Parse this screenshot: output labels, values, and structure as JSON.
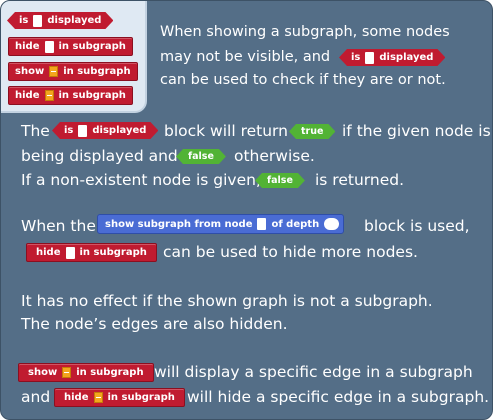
{
  "palette": {
    "is_displayed": {
      "left": "is",
      "right": "displayed"
    },
    "hide_in_subgraph": {
      "left": "hide",
      "right": "in subgraph"
    },
    "show_edge_in_subgraph": {
      "left": "show",
      "right": "in subgraph"
    },
    "hide_edge_in_subgraph": {
      "left": "hide",
      "right": "in subgraph"
    }
  },
  "intro": {
    "line1": "When showing a subgraph, some nodes",
    "line2": "may not be visible, and",
    "line3": "can be used to check if they are or not."
  },
  "para1": {
    "the": "The",
    "block_will_return": "block will return",
    "if_given": "if the given node is",
    "being_displayed": "being displayed and",
    "otherwise": "otherwise.",
    "nonexistent": "If a non-existent node is given,",
    "is_returned": "is returned."
  },
  "para2": {
    "when_the": "When the",
    "block_is_used": "block is used,",
    "can_be_used": "can be used to hide more nodes."
  },
  "para3": {
    "line1": "It has no effect if the shown graph is not a subgraph.",
    "line2": "The node’s edges are also hidden."
  },
  "para4": {
    "line1": "will display a specific edge in a subgraph",
    "and": "and",
    "line2": "will hide a specific edge in a subgraph."
  },
  "blocks": {
    "is": "is",
    "displayed": "displayed",
    "true": "true",
    "false": "false",
    "show_subgraph_left": "show subgraph from node",
    "show_subgraph_right": "of depth",
    "hide": "hide",
    "show": "show",
    "in_subgraph": "in subgraph"
  },
  "colors": {
    "panel": "#546e87",
    "palette": "#dfe9f3",
    "red_block": "#c01b30",
    "green_block": "#52b335",
    "blue_block": "#4a6cd4",
    "edge_slot": "#f3a51c"
  }
}
